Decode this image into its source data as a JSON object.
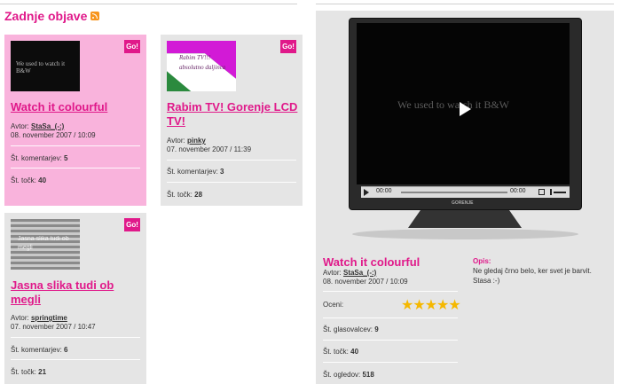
{
  "section": {
    "title": "Zadnje objave"
  },
  "cards": [
    {
      "title": "Watch it colourful",
      "author_label": "Avtor:",
      "author": "StaSa_(-:)",
      "date": "08. november 2007 / 10:09",
      "comments_label": "Št. komentarjev:",
      "comments": "5",
      "points_label": "Št. točk:",
      "points": "40",
      "go": "Go!",
      "thumb_text": "We used to watch it B&W"
    },
    {
      "title": "Rabim TV! Gorenje LCD TV!",
      "author_label": "Avtor:",
      "author": "pinky",
      "date": "07. november 2007 / 11:39",
      "comments_label": "Št. komentarjev:",
      "comments": "3",
      "points_label": "Št. točk:",
      "points": "28",
      "go": "Go!",
      "thumb_text": "Rabim TV!!! absolutno daljinca"
    },
    {
      "title": "Jasna slika tudi ob megli",
      "author_label": "Avtor:",
      "author": "springtime",
      "date": "07. november 2007 / 10:47",
      "comments_label": "Št. komentarjev:",
      "comments": "6",
      "points_label": "Št. točk:",
      "points": "21",
      "go": "Go!",
      "thumb_text": "Jasna slika tudi ob megli"
    }
  ],
  "player": {
    "screen_text": "We used to watch it B&W",
    "time_current": "00:00",
    "time_total": "00:00",
    "tv_brand": "GORENJE"
  },
  "detail": {
    "title": "Watch it colourful",
    "author_label": "Avtor:",
    "author": "StaSa_(-:)",
    "date": "08. november 2007 / 10:09",
    "rate_label": "Oceni:",
    "rating": 5,
    "votes_label": "Št. glasovalcev:",
    "votes": "9",
    "points_label": "Št. točk:",
    "points": "40",
    "views_label": "Št. ogledov:",
    "views": "518",
    "desc_label": "Opis:",
    "desc": "Ne gledaj črno belo, ker svet je barvit. Stasa :-)"
  },
  "colors": {
    "accent": "#e0198a",
    "card_bg": "#e5e5e5",
    "card_active": "#f9b3dc",
    "stars": "#f5b800"
  }
}
